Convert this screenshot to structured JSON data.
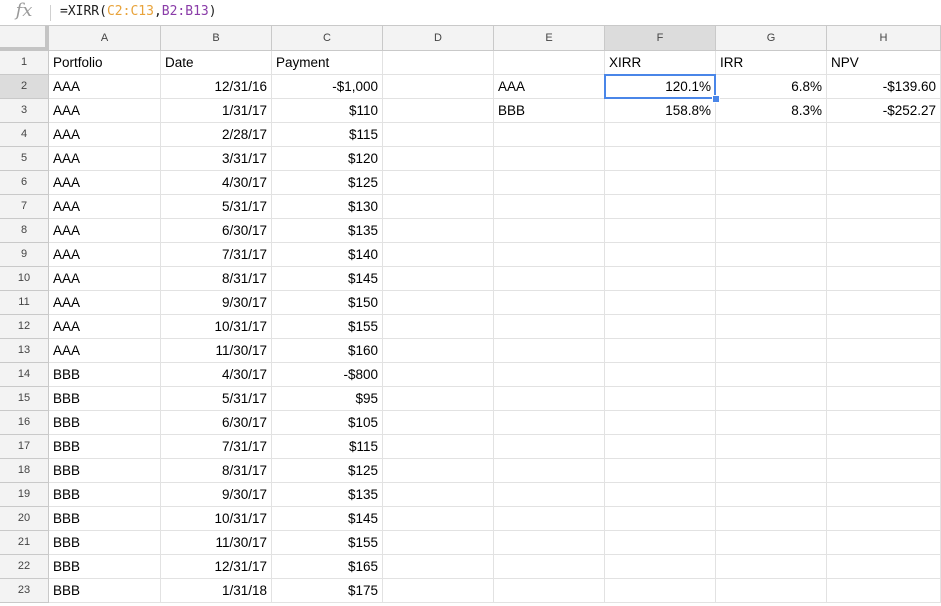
{
  "formula_bar": {
    "fx_label": "fx",
    "formula_prefix": "=XIRR(",
    "formula_ref1": "C2:C13",
    "formula_comma": ",",
    "formula_ref2": "B2:B13",
    "formula_suffix": ")"
  },
  "columns": [
    "A",
    "B",
    "C",
    "D",
    "E",
    "F",
    "G",
    "H"
  ],
  "active_column": "F",
  "active_row": 2,
  "row_numbers": [
    "1",
    "2",
    "3",
    "4",
    "5",
    "6",
    "7",
    "8",
    "9",
    "10",
    "11",
    "12",
    "13",
    "14",
    "15",
    "16",
    "17",
    "18",
    "19",
    "20",
    "21",
    "22",
    "23"
  ],
  "headers": {
    "portfolio": "Portfolio",
    "date": "Date",
    "payment": "Payment",
    "xirr": "XIRR",
    "irr": "IRR",
    "npv": "NPV"
  },
  "cash_flows": [
    {
      "portfolio": "AAA",
      "date": "12/31/16",
      "payment": "-$1,000"
    },
    {
      "portfolio": "AAA",
      "date": "1/31/17",
      "payment": "$110"
    },
    {
      "portfolio": "AAA",
      "date": "2/28/17",
      "payment": "$115"
    },
    {
      "portfolio": "AAA",
      "date": "3/31/17",
      "payment": "$120"
    },
    {
      "portfolio": "AAA",
      "date": "4/30/17",
      "payment": "$125"
    },
    {
      "portfolio": "AAA",
      "date": "5/31/17",
      "payment": "$130"
    },
    {
      "portfolio": "AAA",
      "date": "6/30/17",
      "payment": "$135"
    },
    {
      "portfolio": "AAA",
      "date": "7/31/17",
      "payment": "$140"
    },
    {
      "portfolio": "AAA",
      "date": "8/31/17",
      "payment": "$145"
    },
    {
      "portfolio": "AAA",
      "date": "9/30/17",
      "payment": "$150"
    },
    {
      "portfolio": "AAA",
      "date": "10/31/17",
      "payment": "$155"
    },
    {
      "portfolio": "AAA",
      "date": "11/30/17",
      "payment": "$160"
    },
    {
      "portfolio": "BBB",
      "date": "4/30/17",
      "payment": "-$800"
    },
    {
      "portfolio": "BBB",
      "date": "5/31/17",
      "payment": "$95"
    },
    {
      "portfolio": "BBB",
      "date": "6/30/17",
      "payment": "$105"
    },
    {
      "portfolio": "BBB",
      "date": "7/31/17",
      "payment": "$115"
    },
    {
      "portfolio": "BBB",
      "date": "8/31/17",
      "payment": "$125"
    },
    {
      "portfolio": "BBB",
      "date": "9/30/17",
      "payment": "$135"
    },
    {
      "portfolio": "BBB",
      "date": "10/31/17",
      "payment": "$145"
    },
    {
      "portfolio": "BBB",
      "date": "11/30/17",
      "payment": "$155"
    },
    {
      "portfolio": "BBB",
      "date": "12/31/17",
      "payment": "$165"
    },
    {
      "portfolio": "BBB",
      "date": "1/31/18",
      "payment": "$175"
    }
  ],
  "summary": [
    {
      "portfolio": "AAA",
      "xirr": "120.1%",
      "irr": "6.8%",
      "npv": "-$139.60"
    },
    {
      "portfolio": "BBB",
      "xirr": "158.8%",
      "irr": "8.3%",
      "npv": "-$252.27"
    }
  ],
  "colors": {
    "selection": "#4a86e8",
    "ref1": "#e8a33b",
    "ref2": "#8a3ca8"
  }
}
